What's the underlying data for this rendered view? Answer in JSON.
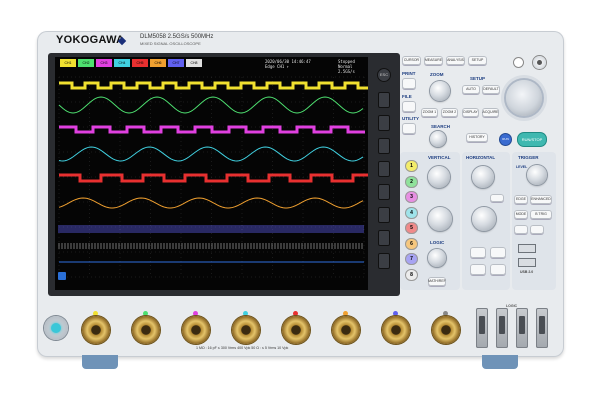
{
  "brand": "YOKOGAWA",
  "model": "DLM5058  2.5GS/s 500MHz",
  "subtitle": "MIXED SIGNAL OSCILLOSCOPE",
  "screen": {
    "channel_tabs": [
      {
        "label": "CH1",
        "color": "#f0e030"
      },
      {
        "label": "CH2",
        "color": "#4ee070"
      },
      {
        "label": "CH3",
        "color": "#e040e0"
      },
      {
        "label": "CH4",
        "color": "#40d0e0"
      },
      {
        "label": "CH5",
        "color": "#e83030"
      },
      {
        "label": "CH6",
        "color": "#f0a030"
      },
      {
        "label": "CH7",
        "color": "#6060f0"
      },
      {
        "label": "CH8",
        "color": "#e0e0e0"
      }
    ],
    "status_line1": "2020/06/30 14:46:47",
    "status_line2": "Edge CH1 ↑",
    "status_right1": "Stopped",
    "status_right2": "Normal",
    "status_right3": "2.5GS/s"
  },
  "softkey_esc": "ESC",
  "panel": {
    "top_row": [
      "CURSOR",
      "MEASURE",
      "ANALYSIS",
      "SETUP"
    ],
    "print": "PRINT",
    "zoom": "ZOOM",
    "zoom_icon": "magnifier-icon",
    "setup": "SETUP",
    "auto": "AUTO",
    "default": "DEFAULT",
    "file": "FILE",
    "zoom1": "ZOOM 1",
    "zoom2": "ZOOM 2",
    "display": "DISPLAY",
    "acquire": "ACQUIRE",
    "utility": "UTILITY",
    "search": "SEARCH",
    "history": "HISTORY",
    "run": "RUN",
    "single": "SINGLE",
    "run_stop": "RUN/STOP",
    "vertical": "VERTICAL",
    "horizontal": "HORIZONTAL",
    "trigger": "TRIGGER",
    "level": "LEVEL",
    "edge": "EDGE",
    "enhanced": "ENHANCED",
    "mode": "MODE",
    "b_trig": "B TRIG",
    "ch_buttons": [
      {
        "label": "1",
        "color": "#f3ec6a"
      },
      {
        "label": "2",
        "color": "#8fe29b"
      },
      {
        "label": "3",
        "color": "#e78fe3"
      },
      {
        "label": "4",
        "color": "#9fe3ea"
      },
      {
        "label": "5",
        "color": "#f08a8a"
      },
      {
        "label": "6",
        "color": "#f6c77e"
      },
      {
        "label": "7",
        "color": "#a7a4f3"
      },
      {
        "label": "8",
        "color": "#ececec"
      }
    ],
    "logic": "LOGIC",
    "math_ref": "MATH/REF",
    "usb_label": "USB 2.0"
  },
  "front": {
    "bnc_colors": [
      "#f0e030",
      "#4ee070",
      "#e040e0",
      "#40d0e0",
      "#e83030",
      "#f0a030",
      "#6060f0",
      "#888888"
    ],
    "bottom_label": "1 MΩ : 16 pF ≤ 300 Vrms  400 Vpk   50 Ω : ≤ 5 Vrms  10 Vpk",
    "logic_label": "LOGIC"
  }
}
